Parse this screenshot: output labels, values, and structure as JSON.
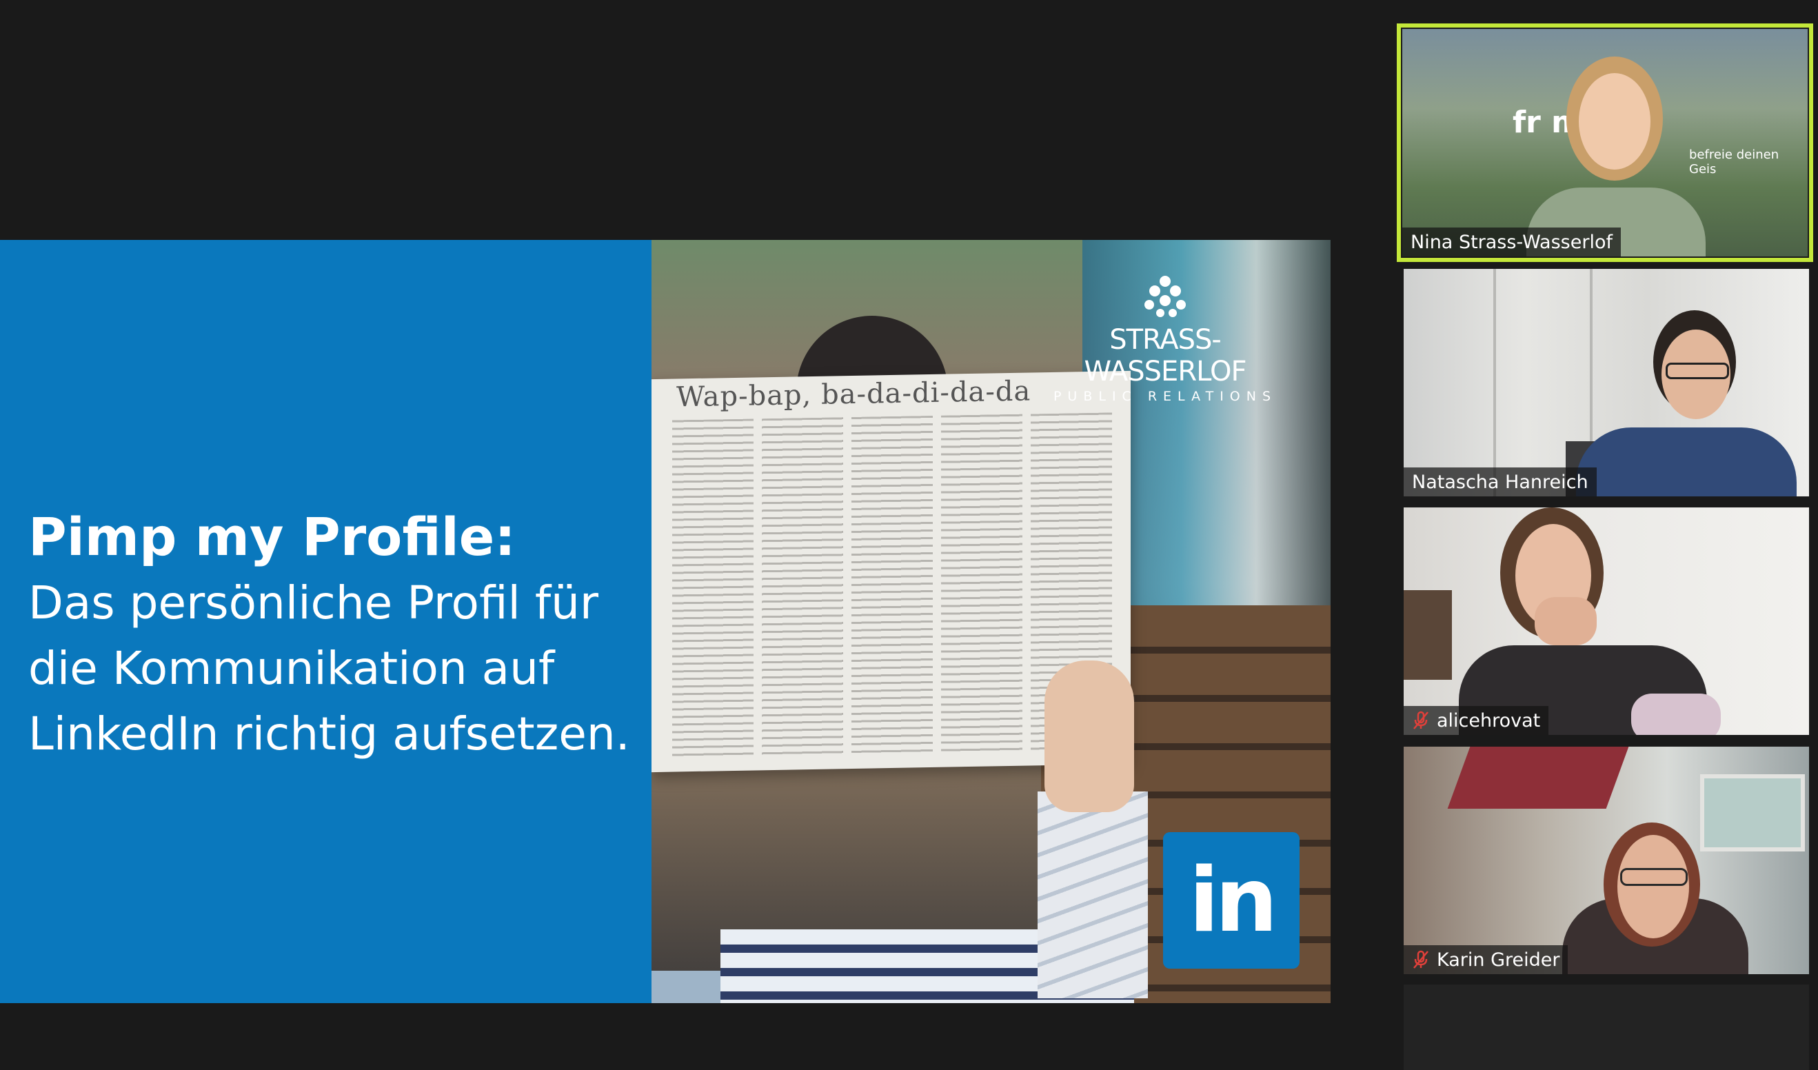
{
  "slide": {
    "title_bold": "Pimp my Profile:",
    "title_lines": [
      "Das persönliche Profil für",
      "die Kommunikation auf",
      "LinkedIn richtig aufsetzen."
    ],
    "brand_name": "STRASS-WASSERLOF",
    "brand_sub": "PUBLIC RELATIONS",
    "newspaper_headline": "Wap-bap, ba-da-di-da-da",
    "linkedin_badge": "in",
    "accent_color": "#0a78bd"
  },
  "participants": [
    {
      "name": "Nina Strass-Wasserlof",
      "muted": false,
      "active_speaker": true,
      "background_text": "fr      mind.",
      "background_sub": "befreie deinen Geis"
    },
    {
      "name": "Natascha Hanreich",
      "muted": false,
      "active_speaker": false
    },
    {
      "name": "alicehrovat",
      "muted": true,
      "active_speaker": false
    },
    {
      "name": "Karin Greider",
      "muted": true,
      "active_speaker": false
    }
  ],
  "colors": {
    "active_speaker_border": "#c4e83a",
    "muted_icon": "#e0403a",
    "window_bg": "#1a1a1a"
  }
}
